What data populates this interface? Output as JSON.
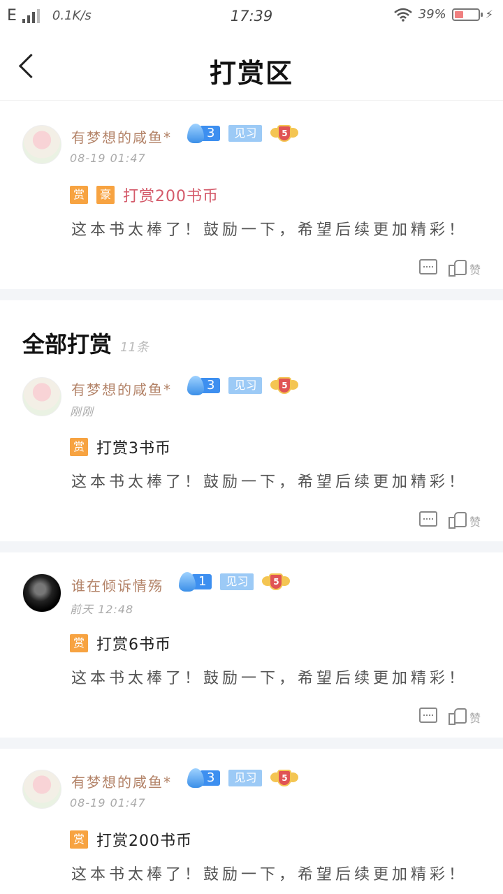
{
  "status_bar": {
    "network": "E",
    "speed": "0.1K/s",
    "time": "17:39",
    "battery": "39%"
  },
  "header": {
    "title": "打赏区"
  },
  "top_card": {
    "username": "有梦想的咸鱼*",
    "fire_level": "3",
    "level_tag": "见习",
    "medal_level": "5",
    "time": "08-19 01:47",
    "tags": [
      "赏",
      "豪"
    ],
    "reward": "打赏200书币",
    "comment": "这本书太棒了！鼓励一下，希望后续更加精彩！",
    "like_label": "赞"
  },
  "section": {
    "title": "全部打赏",
    "count": "11条"
  },
  "items": [
    {
      "username": "有梦想的咸鱼*",
      "fire_level": "3",
      "level_tag": "见习",
      "medal_level": "5",
      "time": "刚刚",
      "tag": "赏",
      "reward": "打赏3书币",
      "comment": "这本书太棒了！鼓励一下，希望后续更加精彩！",
      "like_label": "赞"
    },
    {
      "username": "谁在倾诉情殇",
      "fire_level": "1",
      "level_tag": "见习",
      "medal_level": "5",
      "time": "前天 12:48",
      "tag": "赏",
      "reward": "打赏6书币",
      "comment": "这本书太棒了！鼓励一下，希望后续更加精彩！",
      "like_label": "赞"
    },
    {
      "username": "有梦想的咸鱼*",
      "fire_level": "3",
      "level_tag": "见习",
      "medal_level": "5",
      "time": "08-19 01:47",
      "tag": "赏",
      "reward": "打赏200书币",
      "comment": "这本书太棒了！鼓励一下，希望后续更加精彩！",
      "like_label": "赞"
    }
  ]
}
